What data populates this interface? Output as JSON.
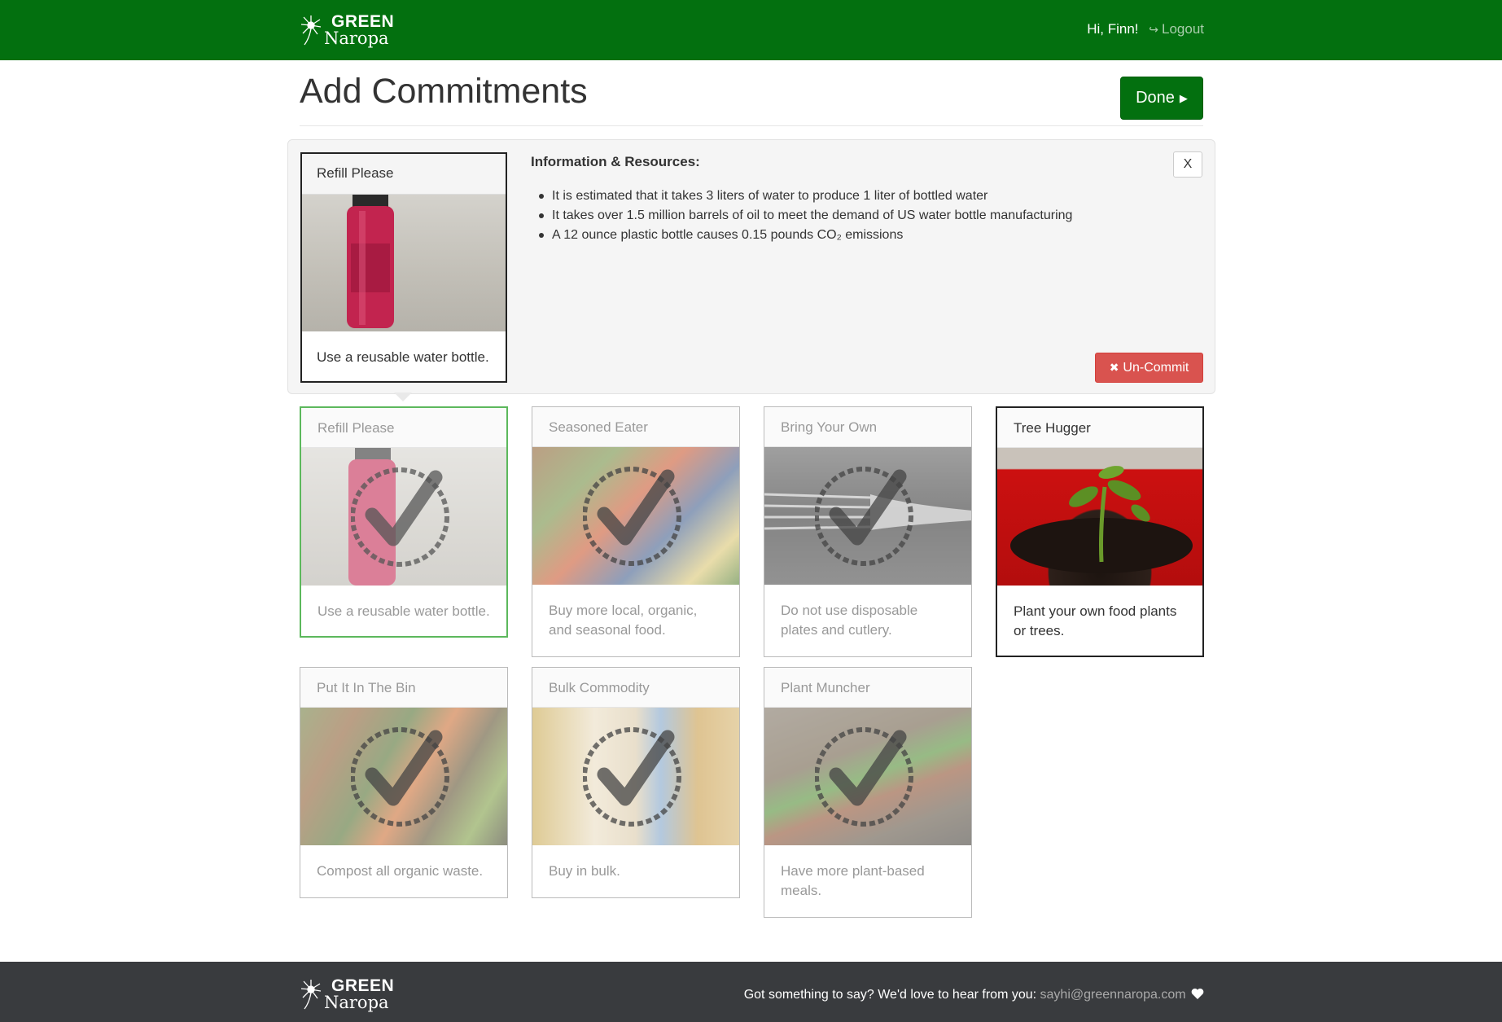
{
  "brand": {
    "line1": "GREEN",
    "line2": "Naropa"
  },
  "nav": {
    "greeting": "Hi, Finn!",
    "logout": "Logout"
  },
  "page": {
    "title": "Add Commitments",
    "done_label": "Done"
  },
  "detail": {
    "card_title": "Refill Please",
    "card_text": "Use a reusable water bottle.",
    "info_heading": "Information & Resources:",
    "facts": [
      "It is estimated that it takes 3 liters of water to produce 1 liter of bottled water",
      "It takes over 1.5 million barrels of oil to meet the demand of US water bottle manufacturing",
      "A 12 ounce plastic bottle causes 0.15 pounds CO₂ emissions"
    ],
    "close_label": "X",
    "uncommit_label": "Un-Commit"
  },
  "cards": [
    {
      "title": "Refill Please",
      "text": "Use a reusable water bottle.",
      "committed": true,
      "image": "water-bottle"
    },
    {
      "title": "Seasoned Eater",
      "text": "Buy more local, organic, and seasonal food.",
      "committed": true,
      "image": "farmers-market"
    },
    {
      "title": "Bring Your Own",
      "text": "Do not use disposable plates and cutlery.",
      "committed": true,
      "image": "plastic-fork"
    },
    {
      "title": "Tree Hugger",
      "text": "Plant your own food plants or trees.",
      "committed": false,
      "image": "seedling-pot"
    },
    {
      "title": "Put It In The Bin",
      "text": "Compost all organic waste.",
      "committed": true,
      "image": "compost"
    },
    {
      "title": "Bulk Commodity",
      "text": "Buy in bulk.",
      "committed": true,
      "image": "bulk-sacks"
    },
    {
      "title": "Plant Muncher",
      "text": "Have more plant-based meals.",
      "committed": true,
      "image": "vegetable-basket"
    }
  ],
  "footer": {
    "message": "Got something to say? We'd love to hear from you: ",
    "email": "sayhi@greennaropa.com",
    "heart_icon": "heart-icon"
  },
  "colors": {
    "brand_green": "#03700f",
    "danger": "#d9534f",
    "footer_bg": "#393b3e"
  }
}
